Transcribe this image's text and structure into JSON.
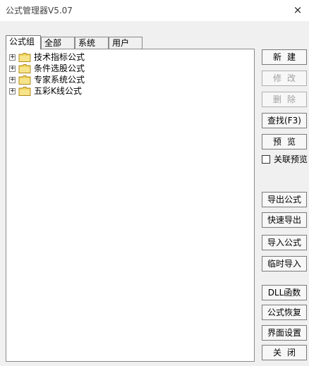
{
  "window": {
    "title": "公式管理器V5.07",
    "close_label": "×"
  },
  "tabs": [
    {
      "label": "公式组",
      "active": true
    },
    {
      "label": "全部",
      "active": false
    },
    {
      "label": "系统",
      "active": false
    },
    {
      "label": "用户",
      "active": false
    }
  ],
  "tree": {
    "items": [
      {
        "expander": "+",
        "label": "技术指标公式"
      },
      {
        "expander": "+",
        "label": "条件选股公式"
      },
      {
        "expander": "+",
        "label": "专家系统公式"
      },
      {
        "expander": "+",
        "label": "五彩K线公式"
      }
    ]
  },
  "buttons": {
    "new": "新建",
    "edit": "修改",
    "delete": "删除",
    "find": "查找(F3)",
    "preview": "预览",
    "export_formula": "导出公式",
    "quick_export": "快速导出",
    "import_formula": "导入公式",
    "temp_import": "临时导入",
    "dll_function": "DLL函数",
    "restore_formula": "公式恢复",
    "ui_settings": "界面设置",
    "close": "关闭"
  },
  "link_preview": {
    "label": "关联预览",
    "checked": false
  },
  "colors": {
    "folder": "#f2d45c",
    "window_bg": "#f0f0f0",
    "disabled_text": "#a0a0a0"
  }
}
